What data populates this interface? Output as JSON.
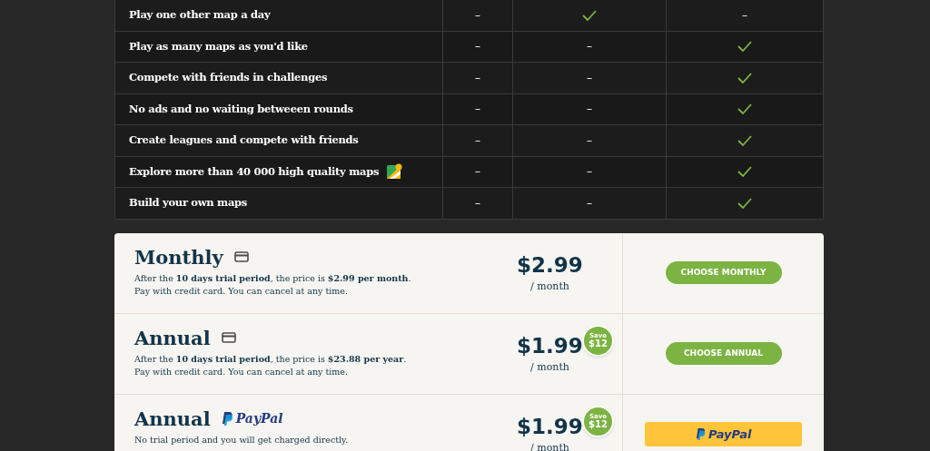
{
  "features": [
    {
      "label": "Play one other map a day",
      "map_icon": false,
      "cells": [
        {
          "kind": "dash",
          "text": "–"
        },
        {
          "kind": "check"
        },
        {
          "kind": "dash",
          "text": "–"
        }
      ]
    },
    {
      "label": "Play as many maps as you'd like",
      "map_icon": false,
      "cells": [
        {
          "kind": "dash",
          "text": "–"
        },
        {
          "kind": "dash",
          "text": "–"
        },
        {
          "kind": "check"
        }
      ]
    },
    {
      "label": "Compete with friends in challenges",
      "map_icon": false,
      "cells": [
        {
          "kind": "dash",
          "text": "–"
        },
        {
          "kind": "dash",
          "text": "–"
        },
        {
          "kind": "check"
        }
      ]
    },
    {
      "label": "No ads and no waiting betweeen rounds",
      "map_icon": false,
      "cells": [
        {
          "kind": "dash",
          "text": "–"
        },
        {
          "kind": "dash",
          "text": "–"
        },
        {
          "kind": "check"
        }
      ]
    },
    {
      "label": "Create leagues and compete with friends",
      "map_icon": false,
      "cells": [
        {
          "kind": "dash",
          "text": "–"
        },
        {
          "kind": "dash",
          "text": "–"
        },
        {
          "kind": "check"
        }
      ]
    },
    {
      "label": "Explore more than 40 000 high quality maps",
      "map_icon": true,
      "cells": [
        {
          "kind": "dash",
          "text": "–"
        },
        {
          "kind": "dash",
          "text": "–"
        },
        {
          "kind": "check"
        }
      ]
    },
    {
      "label": "Build your own maps",
      "map_icon": false,
      "cells": [
        {
          "kind": "dash",
          "text": "–"
        },
        {
          "kind": "dash",
          "text": "–"
        },
        {
          "kind": "check"
        }
      ]
    }
  ],
  "plans": [
    {
      "name": "Monthly",
      "kind": "card",
      "description": [
        "After the **10 days trial period**, the price is **$2.99 per month**.",
        "Pay with credit card. You can cancel at any time."
      ],
      "price": "$2.99",
      "period": "/ month",
      "action": {
        "kind": "button",
        "label": "CHOOSE MONTHLY"
      }
    },
    {
      "name": "Annual",
      "kind": "card",
      "description": [
        "After the **10 days trial period**, the price is **$23.88 per year**.",
        "Pay with credit card. You can cancel at any time."
      ],
      "price": "$1.99",
      "period": "/ month",
      "save": {
        "top": "Save",
        "bottom": "$12"
      },
      "action": {
        "kind": "button",
        "label": "CHOOSE ANNUAL"
      }
    },
    {
      "name": "Annual",
      "kind": "paypal",
      "payment_label": "PayPal",
      "description": [
        "No trial period and you will get charged directly."
      ],
      "price": "$1.99",
      "period": "/ month",
      "save": {
        "top": "Save",
        "bottom": "$12"
      },
      "action": {
        "kind": "paypal",
        "label": "PayPal"
      }
    }
  ]
}
